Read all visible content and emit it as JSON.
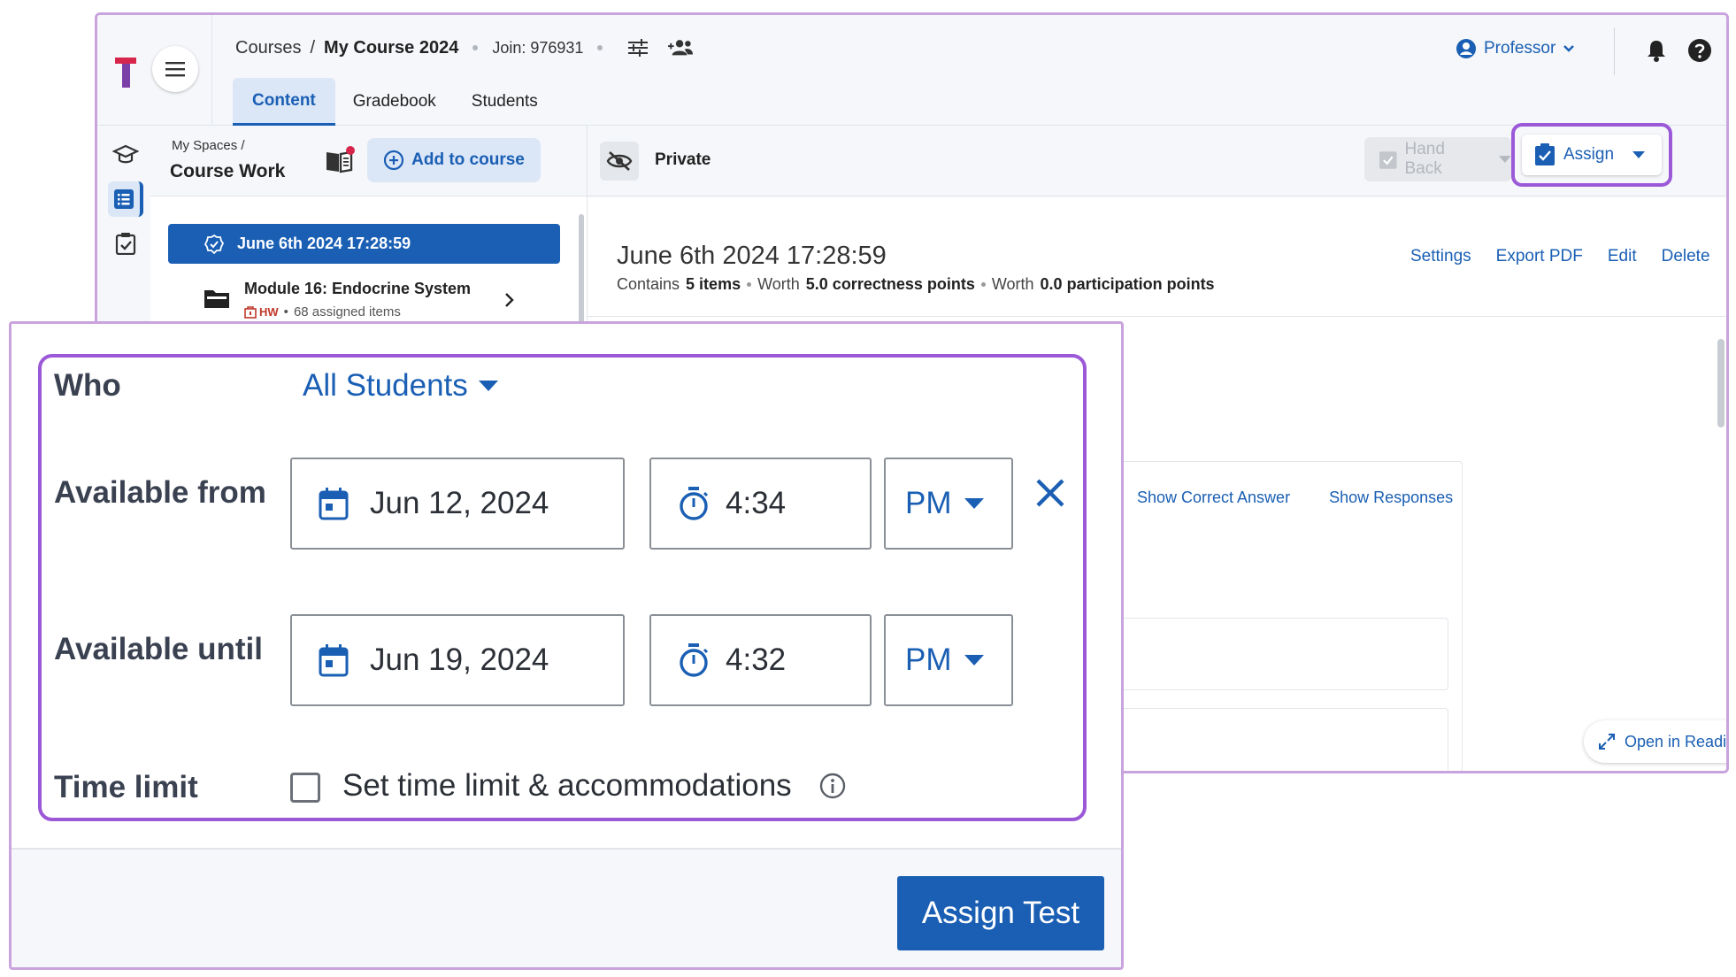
{
  "header": {
    "breadcrumb_root": "Courses",
    "breadcrumb_sep": "/",
    "course_name": "My Course 2024",
    "join_code": "Join: 976931",
    "role": "Professor"
  },
  "tabs": [
    {
      "label": "Content",
      "active": true
    },
    {
      "label": "Gradebook",
      "active": false
    },
    {
      "label": "Students",
      "active": false
    }
  ],
  "sidebar": {
    "crumb": "My Spaces /",
    "title": "Course Work",
    "add_button": "Add to course",
    "selected_item": "June 6th 2024 17:28:59",
    "module": {
      "title": "Module 16: Endocrine System",
      "badge": "HW",
      "sub": "68 assigned items"
    }
  },
  "toolbar": {
    "visibility": "Private",
    "hand_back": "Hand Back",
    "assign": "Assign"
  },
  "detail": {
    "title": "June 6th 2024 17:28:59",
    "meta_1": "Contains",
    "items": "5 items",
    "meta_2": "Worth",
    "correctness": "5.0 correctness points",
    "meta_3": "Worth",
    "participation": "0.0 participation points",
    "links": [
      "Settings",
      "Export PDF",
      "Edit",
      "Delete"
    ],
    "show_correct": "Show Correct Answer",
    "show_responses": "Show Responses",
    "reading_view": "Open in Reading View"
  },
  "dialog": {
    "who_label": "Who",
    "who_value": "All Students",
    "from_label": "Available from",
    "from_date": "Jun 12, 2024",
    "from_time": "4:34",
    "from_ampm": "PM",
    "until_label": "Available until",
    "until_date": "Jun 19, 2024",
    "until_time": "4:32",
    "until_ampm": "PM",
    "timelimit_label": "Time limit",
    "timelimit_checkbox": "Set time limit & accommodations",
    "timelimit_checked": false,
    "submit": "Assign Test"
  },
  "colors": {
    "brand_blue": "#1a5fb4",
    "highlight_purple": "#9b59d8",
    "logo_red": "#d7264b",
    "logo_purple": "#7b3fa8"
  }
}
